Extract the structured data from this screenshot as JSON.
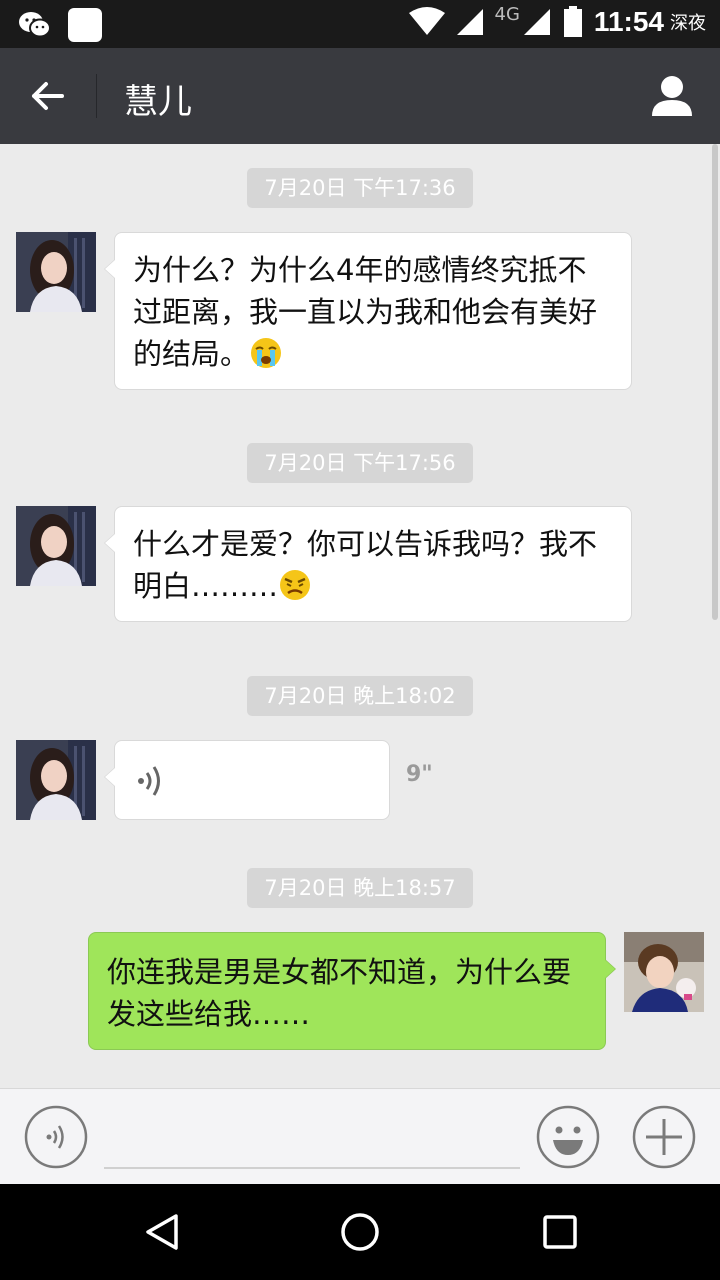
{
  "status_bar": {
    "network": "4G",
    "time": "11:54",
    "period": "深夜",
    "icons": [
      "wechat-icon",
      "app-icon",
      "wifi-icon",
      "signal-icon",
      "battery-icon"
    ]
  },
  "header": {
    "title": "慧儿",
    "back_icon": "arrow-left-icon",
    "profile_icon": "person-icon",
    "background": "#393a3f"
  },
  "messages": {
    "ts1": "7月20日 下午17:36",
    "m1": "为什么？为什么4年的感情终究抵不过距离，我一直以为我和他会有美好的结局。",
    "m1_emoji": "crying-emoji",
    "ts2": "7月20日 下午17:56",
    "m2": "什么才是爱？你可以告诉我吗？我不明白………",
    "m2_emoji": "angry-crying-emoji",
    "ts3": "7月20日 晚上18:02",
    "voice_duration": "9\"",
    "ts4": "7月20日 晚上18:57",
    "m4": "你连我是男是女都不知道，为什么要发这些给我……"
  },
  "input_bar": {
    "voice_icon": "voice-icon",
    "emoji_icon": "smiley-icon",
    "plus_icon": "plus-icon",
    "placeholder": ""
  },
  "nav_bar": {
    "icons": [
      "back-triangle-icon",
      "home-circle-icon",
      "recent-square-icon"
    ]
  },
  "colors": {
    "outgoing_bubble": "#9fe55a",
    "incoming_bubble": "#ffffff",
    "chat_background": "#ebebeb"
  }
}
